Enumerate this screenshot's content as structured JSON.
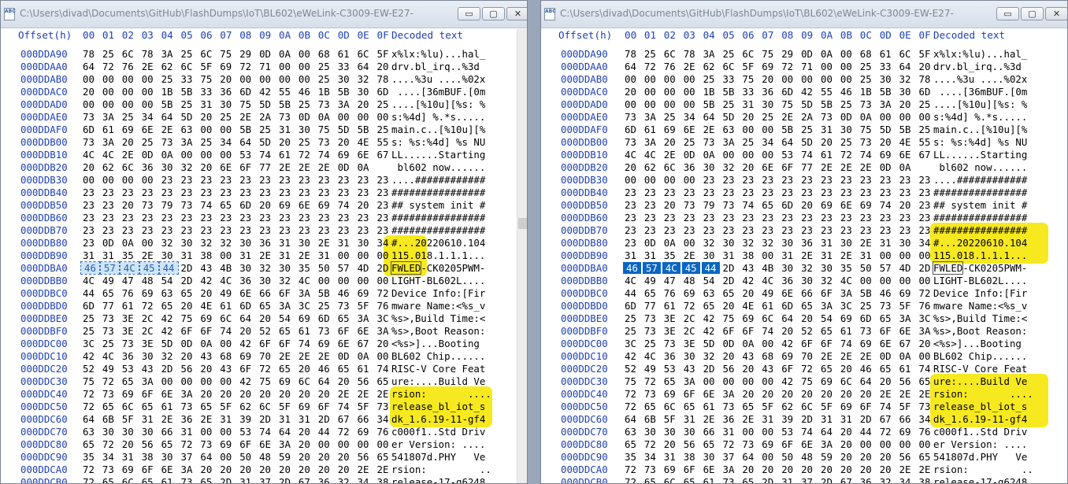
{
  "titlebar_text": "C:\\Users\\divad\\Documents\\GitHub\\FlashDumps\\IoT\\BL602\\eWeLink-C3009-EW-E27-BW2L-RGBCW-...",
  "app_icon_label": "ABC",
  "buttons": {
    "minimize": "▭",
    "maximize": "▢",
    "close": "✕"
  },
  "columns": {
    "offset": "Offset(h)",
    "bytes": [
      "00",
      "01",
      "02",
      "03",
      "04",
      "05",
      "06",
      "07",
      "08",
      "09",
      "0A",
      "0B",
      "0C",
      "0D",
      "0E",
      "0F"
    ],
    "decoded": "Decoded text"
  },
  "rows": [
    {
      "o": "000DDA90",
      "h": "78 25 6C 78 3A 25 6C 75 29 0D 0A 00 68 61 6C 5F",
      "t": "x%lx:%lu)...hal_"
    },
    {
      "o": "000DDAA0",
      "h": "64 72 76 2E 62 6C 5F 69 72 71 00 00 25 33 64 20",
      "t": "drv.bl_irq..%3d "
    },
    {
      "o": "000DDAB0",
      "h": "00 00 00 00 25 33 75 20 00 00 00 00 25 30 32 78",
      "t": "....%3u ....%02x"
    },
    {
      "o": "000DDAC0",
      "h": "20 00 00 00 1B 5B 33 36 6D 42 55 46 1B 5B 30 6D",
      "t": " ....[36mBUF.[0m"
    },
    {
      "o": "000DDAD0",
      "h": "00 00 00 00 5B 25 31 30 75 5D 5B 25 73 3A 20 25",
      "t": "....[%10u][%s: %"
    },
    {
      "o": "000DDAE0",
      "h": "73 3A 25 34 64 5D 20 25 2E 2A 73 0D 0A 00 00 00",
      "t": "s:%4d] %.*s....."
    },
    {
      "o": "000DDAF0",
      "h": "6D 61 69 6E 2E 63 00 00 5B 25 31 30 75 5D 5B 25",
      "t": "main.c..[%10u][%"
    },
    {
      "o": "000DDB00",
      "h": "73 3A 20 25 73 3A 25 34 64 5D 20 25 73 20 4E 55",
      "t": "s: %s:%4d] %s NU"
    },
    {
      "o": "000DDB10",
      "h": "4C 4C 2E 0D 0A 00 00 00 53 74 61 72 74 69 6E 67",
      "t": "LL......Starting"
    },
    {
      "o": "000DDB20",
      "h": "20 62 6C 36 30 32 20 6E 6F 77 2E 2E 2E 0D 0A",
      "t": " bl602 now......"
    },
    {
      "o": "000DDB30",
      "h": "00 00 00 00 23 23 23 23 23 23 23 23 23 23 23 23",
      "t": "....############"
    },
    {
      "o": "000DDB40",
      "h": "23 23 23 23 23 23 23 23 23 23 23 23 23 23 23 23",
      "t": "################"
    },
    {
      "o": "000DDB50",
      "h": "23 23 20 73 79 73 74 65 6D 20 69 6E 69 74 20 23",
      "t": "## system init #"
    },
    {
      "o": "000DDB60",
      "h": "23 23 23 23 23 23 23 23 23 23 23 23 23 23 23 23",
      "t": "################"
    },
    {
      "o": "000DDB70",
      "h": "23 23 23 23 23 23 23 23 23 23 23 23 23 23 23 23",
      "t": "################"
    },
    {
      "o": "000DDB80",
      "h": "23 0D 0A 00 32 30 32 32 30 36 31 30 2E 31 30 34",
      "t": "#...20220610.104"
    },
    {
      "o": "000DDB90",
      "h": "31 31 35 2E 30 31 38 00 31 2E 31 2E 31 00 00 00",
      "t": "115.018.1.1.1..."
    },
    {
      "o": "000DDBA0",
      "h": "46 57 4C 45 44 2D 43 4B 30 32 30 35 50 57 4D 2D",
      "t": "FWLED-CK0205PWM-"
    },
    {
      "o": "000DDBB0",
      "h": "4C 49 47 48 54 2D 42 4C 36 30 32 4C 00 00 00 00",
      "t": "LIGHT-BL602L...."
    },
    {
      "o": "000DDBC0",
      "h": "44 65 76 69 63 65 20 49 6E 66 6F 3A 5B 46 69 72",
      "t": "Device Info:[Fir"
    },
    {
      "o": "000DDBD0",
      "h": "6D 77 61 72 65 20 4E 61 6D 65 3A 3C 25 73 5F 76",
      "t": "mware Name:<%s_v"
    },
    {
      "o": "000DDBE0",
      "h": "25 73 3E 2C 42 75 69 6C 64 20 54 69 6D 65 3A 3C",
      "t": "%s>,Build Time:<"
    },
    {
      "o": "000DDBF0",
      "h": "25 73 3E 2C 42 6F 6F 74 20 52 65 61 73 6F 6E 3A",
      "t": "%s>,Boot Reason:"
    },
    {
      "o": "000DDC00",
      "h": "3C 25 73 3E 5D 0D 0A 00 42 6F 6F 74 69 6E 67 20",
      "t": "<%s>]...Booting "
    },
    {
      "o": "000DDC10",
      "h": "42 4C 36 30 32 20 43 68 69 70 2E 2E 2E 0D 0A 00",
      "t": "BL602 Chip......"
    },
    {
      "o": "000DDC20",
      "h": "52 49 53 43 2D 56 20 43 6F 72 65 20 46 65 61 74",
      "t": "RISC-V Core Feat"
    },
    {
      "o": "000DDC30",
      "h": "75 72 65 3A 00 00 00 00 42 75 69 6C 64 20 56 65",
      "t": "ure:....Build Ve"
    },
    {
      "o": "000DDC40",
      "h": "72 73 69 6F 6E 3A 20 20 20 20 20 20 20 2E 2E 2E",
      "t": "rsion:       ...."
    },
    {
      "o": "000DDC50",
      "h": "72 65 6C 65 61 73 65 5F 62 6C 5F 69 6F 74 5F 73",
      "t": "release_bl_iot_s"
    },
    {
      "o": "000DDC60",
      "h": "64 6B 5F 31 2E 36 2E 31 39 2D 31 31 2D 67 66 34",
      "t": "dk_1.6.19-11-gf4"
    },
    {
      "o": "000DDC70",
      "h": "63 30 30 30 66 31 00 00 53 74 64 20 44 72 69 76",
      "t": "c000f1..Std Driv"
    },
    {
      "o": "000DDC80",
      "h": "65 72 20 56 65 72 73 69 6F 6E 3A 20 00 00 00 00",
      "t": "er Version: ...."
    },
    {
      "o": "000DDC90",
      "h": "35 34 31 38 30 37 64 00 50 48 59 20 20 20 56 65",
      "t": "541807d.PHY   Ve"
    },
    {
      "o": "000DDCA0",
      "h": "72 73 69 6F 6E 3A 20 20 20 20 20 20 20 20 2E 2E",
      "t": "rsion:         .."
    },
    {
      "o": "000DDCB0",
      "h": "72 65 6C 65 61 73 65 2D 31 37 2D 67 36 32 34 38",
      "t": "release-17-g6248"
    }
  ],
  "colors": {
    "offset_header": "#1d3fb8",
    "highlight": "#f6e600",
    "selection": "#0a66c4"
  }
}
